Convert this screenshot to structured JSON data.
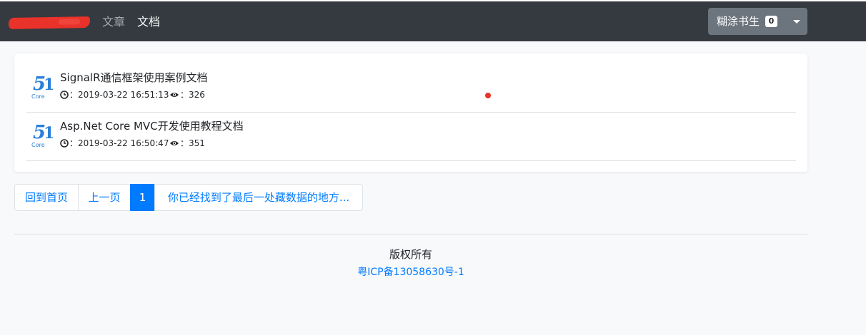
{
  "navbar": {
    "links": [
      {
        "label": "文章"
      },
      {
        "label": "文档"
      }
    ],
    "user": {
      "name": "糊涂书生",
      "badge": "0"
    }
  },
  "docs": [
    {
      "logo_text": "Core",
      "title": "SignalR通信框架使用案例文档",
      "time_sep": "：",
      "date": "2019-03-22 16:51:13",
      "views_sep": "：",
      "views": "326"
    },
    {
      "logo_text": "Core",
      "title": "Asp.Net Core MVC开发使用教程文档",
      "time_sep": "：",
      "date": "2019-03-22 16:50:47",
      "views_sep": "：",
      "views": "351"
    }
  ],
  "pagination": {
    "home": "回到首页",
    "prev": "上一页",
    "current": "1",
    "end_note": "你已经找到了最后一处藏数据的地方..."
  },
  "footer": {
    "copyright": "版权所有",
    "icp": "粤ICP备13058630号-1"
  },
  "colors": {
    "navbar_bg": "#343a40",
    "primary": "#007bff",
    "user_button": "#6c757d",
    "redaction": "#e8322a"
  },
  "icons": {
    "clock": "clock-icon",
    "eye": "eye-icon",
    "caret": "chevron-down-icon",
    "logo": "51core-logo"
  }
}
